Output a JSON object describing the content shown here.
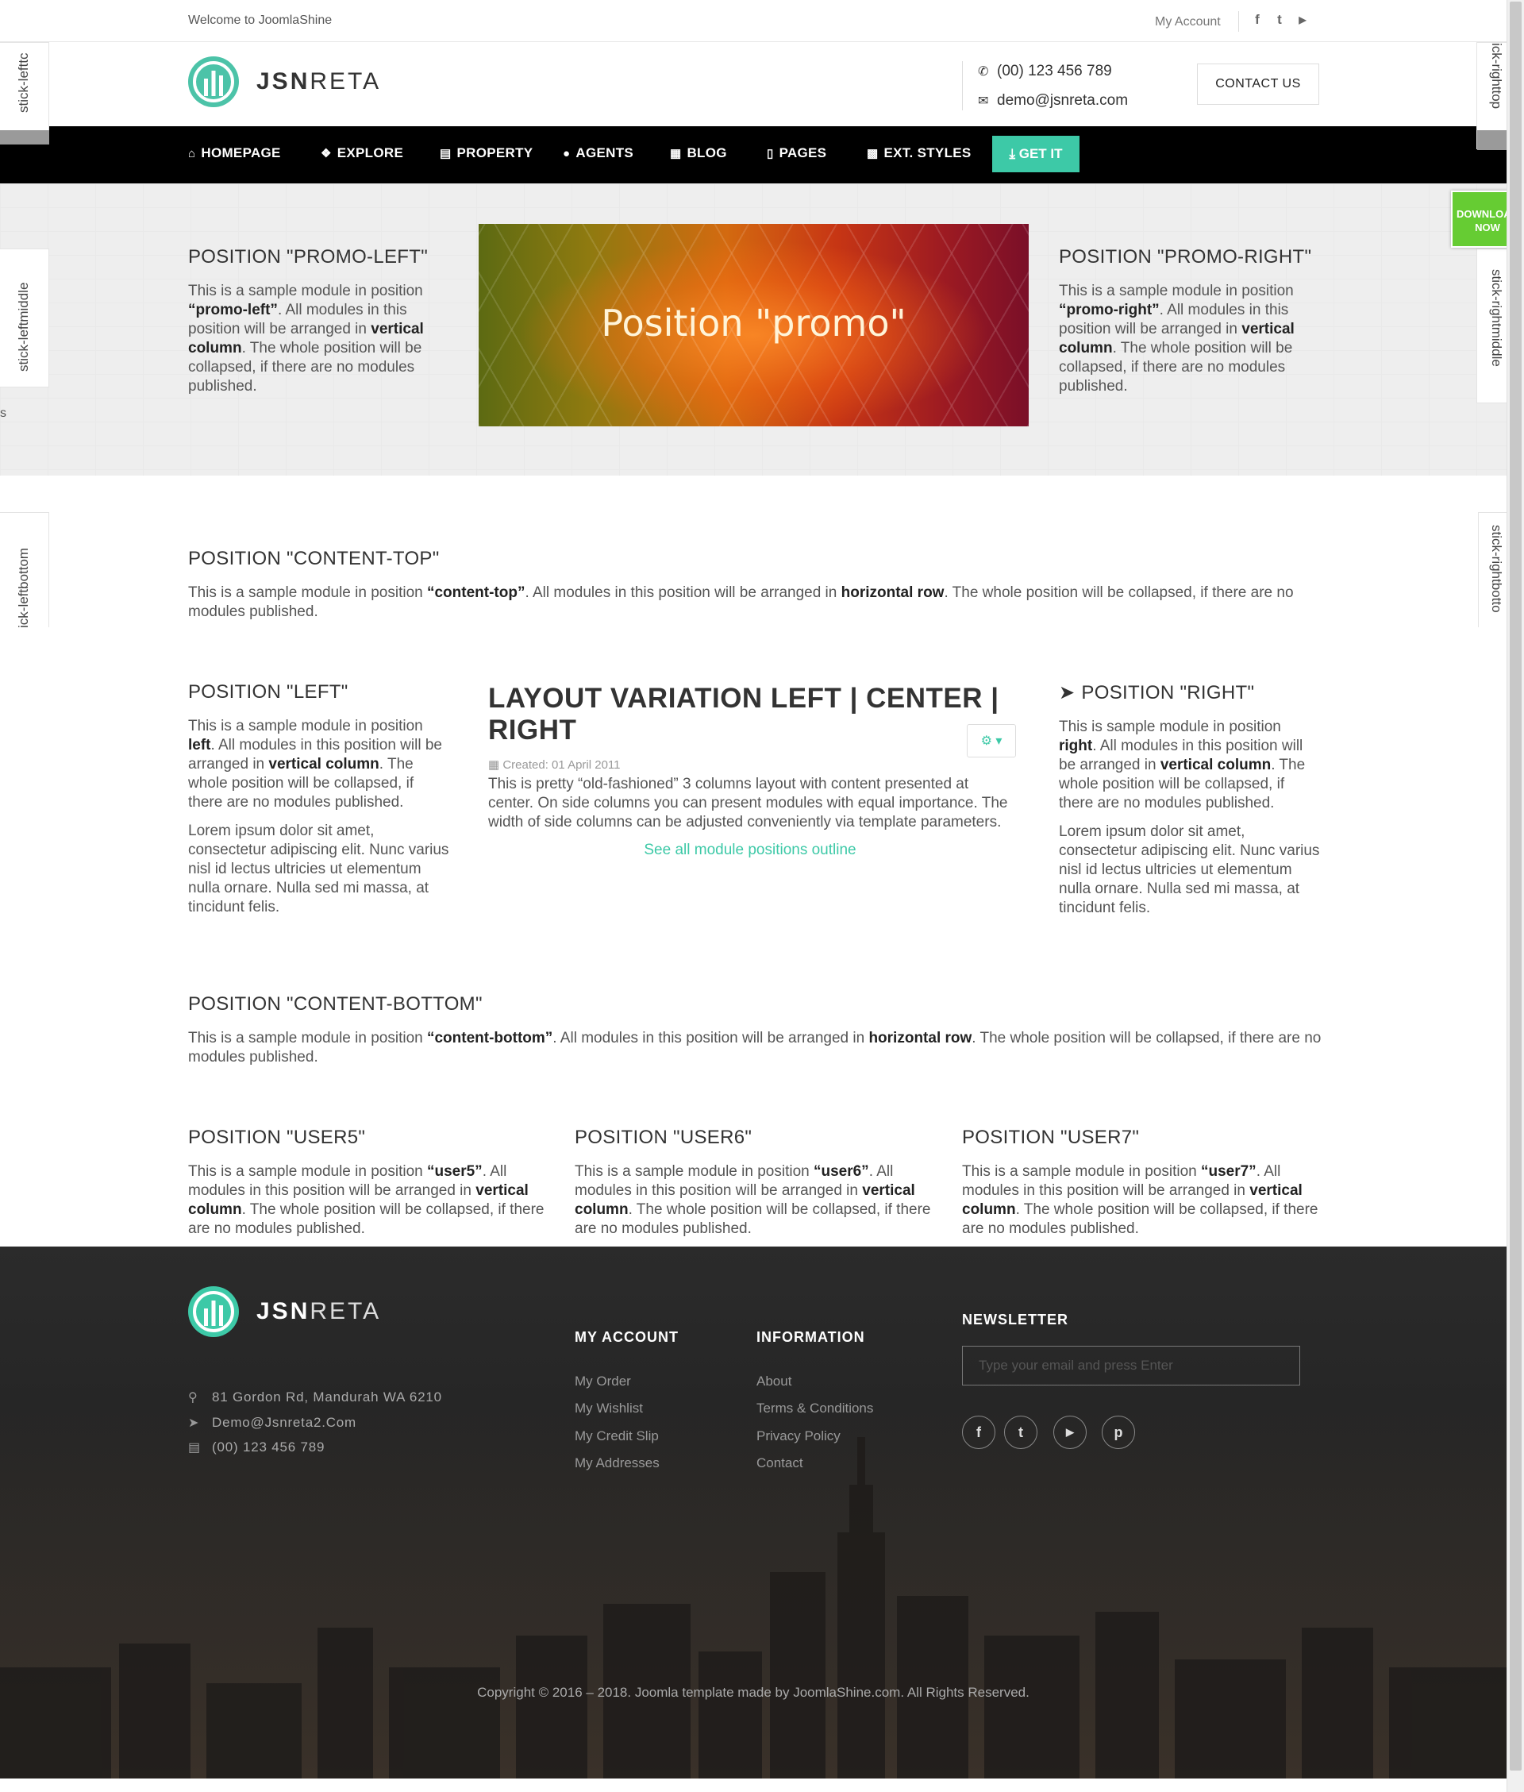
{
  "topbar": {
    "welcome": "Welcome to JoomlaShine",
    "my_account": "My Account",
    "social": [
      {
        "icon": "facebook-icon",
        "glyph": "f"
      },
      {
        "icon": "twitter-icon",
        "glyph": "t"
      },
      {
        "icon": "youtube-icon",
        "glyph": "▶"
      }
    ]
  },
  "header": {
    "logo_bold": "JSN",
    "logo_light": "RETA",
    "phone": "(00) 123 456 789",
    "email": "demo@jsnreta.com",
    "contact_button": "CONTACT US"
  },
  "nav": {
    "items": [
      {
        "label": "HOMEPAGE",
        "icon": "home-icon",
        "glyph": "⌂"
      },
      {
        "label": "EXPLORE",
        "icon": "cubes-icon",
        "glyph": "❖"
      },
      {
        "label": "PROPERTY",
        "icon": "building-icon",
        "glyph": "▤"
      },
      {
        "label": "AGENTS",
        "icon": "user-icon",
        "glyph": "●"
      },
      {
        "label": "BLOG",
        "icon": "newspaper-icon",
        "glyph": "▦"
      },
      {
        "label": "PAGES",
        "icon": "file-icon",
        "glyph": "▯"
      },
      {
        "label": "EXT. STYLES",
        "icon": "grid-icon",
        "glyph": "▩"
      }
    ],
    "get_it": "GET IT"
  },
  "sticks": {
    "left_top": "stick-lefttc",
    "left_middle": "stick-leftmiddle",
    "left_bottom": "ick-leftbottom",
    "right_top": "ick-righttop",
    "right_middle": "stick-rightmiddle",
    "right_bottom": "stick-rightbotto",
    "left_stray": "s"
  },
  "download": {
    "line1": "DOWNLOAD",
    "line2": "NOW"
  },
  "promo": {
    "left_title": "POSITION \"PROMO-LEFT\"",
    "left_p1": "This is a sample module in position ",
    "left_b1": "“promo-left”",
    "left_p2": ". All modules in this position will be arranged in ",
    "left_b2": "vertical column",
    "left_p3": ". The whole position will be collapsed, if there are no modules published.",
    "image_text": "Position \"promo\"",
    "right_title": "POSITION \"PROMO-RIGHT\"",
    "right_p1": "This is a sample module in position ",
    "right_b1": "“promo-right”",
    "right_p2": ". All modules in this position will be arranged in ",
    "right_b2": "vertical column",
    "right_p3": ". The whole position will be collapsed, if there are no modules published."
  },
  "content_top": {
    "title": "POSITION \"CONTENT-TOP\"",
    "p1": "This is a sample module in position ",
    "b1": "“content-top”",
    "p2": ". All modules in this position will be arranged in ",
    "b2": "horizontal row",
    "p3": ". The whole position will be collapsed, if there are no modules published."
  },
  "left": {
    "title": "POSITION \"LEFT\"",
    "p1": "This is a sample module in position ",
    "b1": "left",
    "p2": ". All modules in this position will be arranged in ",
    "b2": "vertical column",
    "p3": ". The whole position will be collapsed, if there are no modules published.",
    "lorem": "Lorem ipsum dolor sit amet, consectetur adipiscing elit. Nunc varius nisl id lectus ultricies ut elementum nulla ornare. Nulla sed mi massa, at tincidunt felis."
  },
  "center": {
    "title": "LAYOUT VARIATION LEFT | CENTER | RIGHT",
    "created": "Created: 01 April 2011",
    "body": "This is pretty “old-fashioned” 3 columns layout with content presented at center. On side columns you can present modules with equal importance. The width of side columns can be adjusted conveniently via template parameters.",
    "link": "See all module positions outline"
  },
  "right": {
    "title": "POSITION \"RIGHT\"",
    "p1": "This is sample module in position ",
    "b1": "right",
    "p2": ". All modules in this position will be arranged in ",
    "b2": "vertical column",
    "p3": ". The whole position will be collapsed, if there are no modules published.",
    "lorem": "Lorem ipsum dolor sit amet, consectetur adipiscing elit. Nunc varius nisl id lectus ultricies ut elementum nulla ornare. Nulla sed mi massa, at tincidunt felis."
  },
  "content_bottom": {
    "title": "POSITION \"CONTENT-BOTTOM\"",
    "p1": "This is a sample module in position ",
    "b1": "“content-bottom”",
    "p2": ". All modules in this position will be arranged in ",
    "b2": "horizontal row",
    "p3": ". The whole position will be collapsed, if there are no modules published."
  },
  "users": [
    {
      "title": "POSITION \"USER5\"",
      "p1": "This is a sample module in position ",
      "b1": "“user5”",
      "p2": ". All modules in this position will be arranged in ",
      "b2": "vertical column",
      "p3": ". The whole position will be collapsed, if there are no modules published."
    },
    {
      "title": "POSITION \"USER6\"",
      "p1": "This is a sample module in position ",
      "b1": "“user6”",
      "p2": ". All modules in this position will be arranged in ",
      "b2": "vertical column",
      "p3": ". The whole position will be collapsed, if there are no modules published."
    },
    {
      "title": "POSITION \"USER7\"",
      "p1": "This is a sample module in position ",
      "b1": "“user7”",
      "p2": ". All modules in this position will be arranged in ",
      "b2": "vertical column",
      "p3": ". The whole position will be collapsed, if there are no modules published."
    }
  ],
  "footer": {
    "logo_bold": "JSN",
    "logo_light": "RETA",
    "address": "81 Gordon Rd, Mandurah WA 6210",
    "email": "Demo@Jsnreta2.Com",
    "phone": "(00) 123 456 789",
    "my_account_title": "MY ACCOUNT",
    "my_account_links": [
      "My Order",
      "My Wishlist",
      "My Credit Slip",
      "My Addresses"
    ],
    "information_title": "INFORMATION",
    "information_links": [
      "About",
      "Terms & Conditions",
      "Privacy Policy",
      "Contact"
    ],
    "newsletter_title": "NEWSLETTER",
    "newsletter_placeholder": "Type your email and press Enter",
    "social": [
      {
        "icon": "facebook-icon",
        "glyph": "f"
      },
      {
        "icon": "twitter-icon",
        "glyph": "t"
      },
      {
        "icon": "youtube-icon",
        "glyph": "▶"
      },
      {
        "icon": "pinterest-icon",
        "glyph": "p"
      }
    ],
    "copyright": "Copyright © 2016 – 2018. Joomla template made by JoomlaShine.com. All Rights Reserved."
  },
  "colors": {
    "accent": "#3dc9a7",
    "nav_bg": "#000000",
    "download_bg": "#66cc33"
  }
}
